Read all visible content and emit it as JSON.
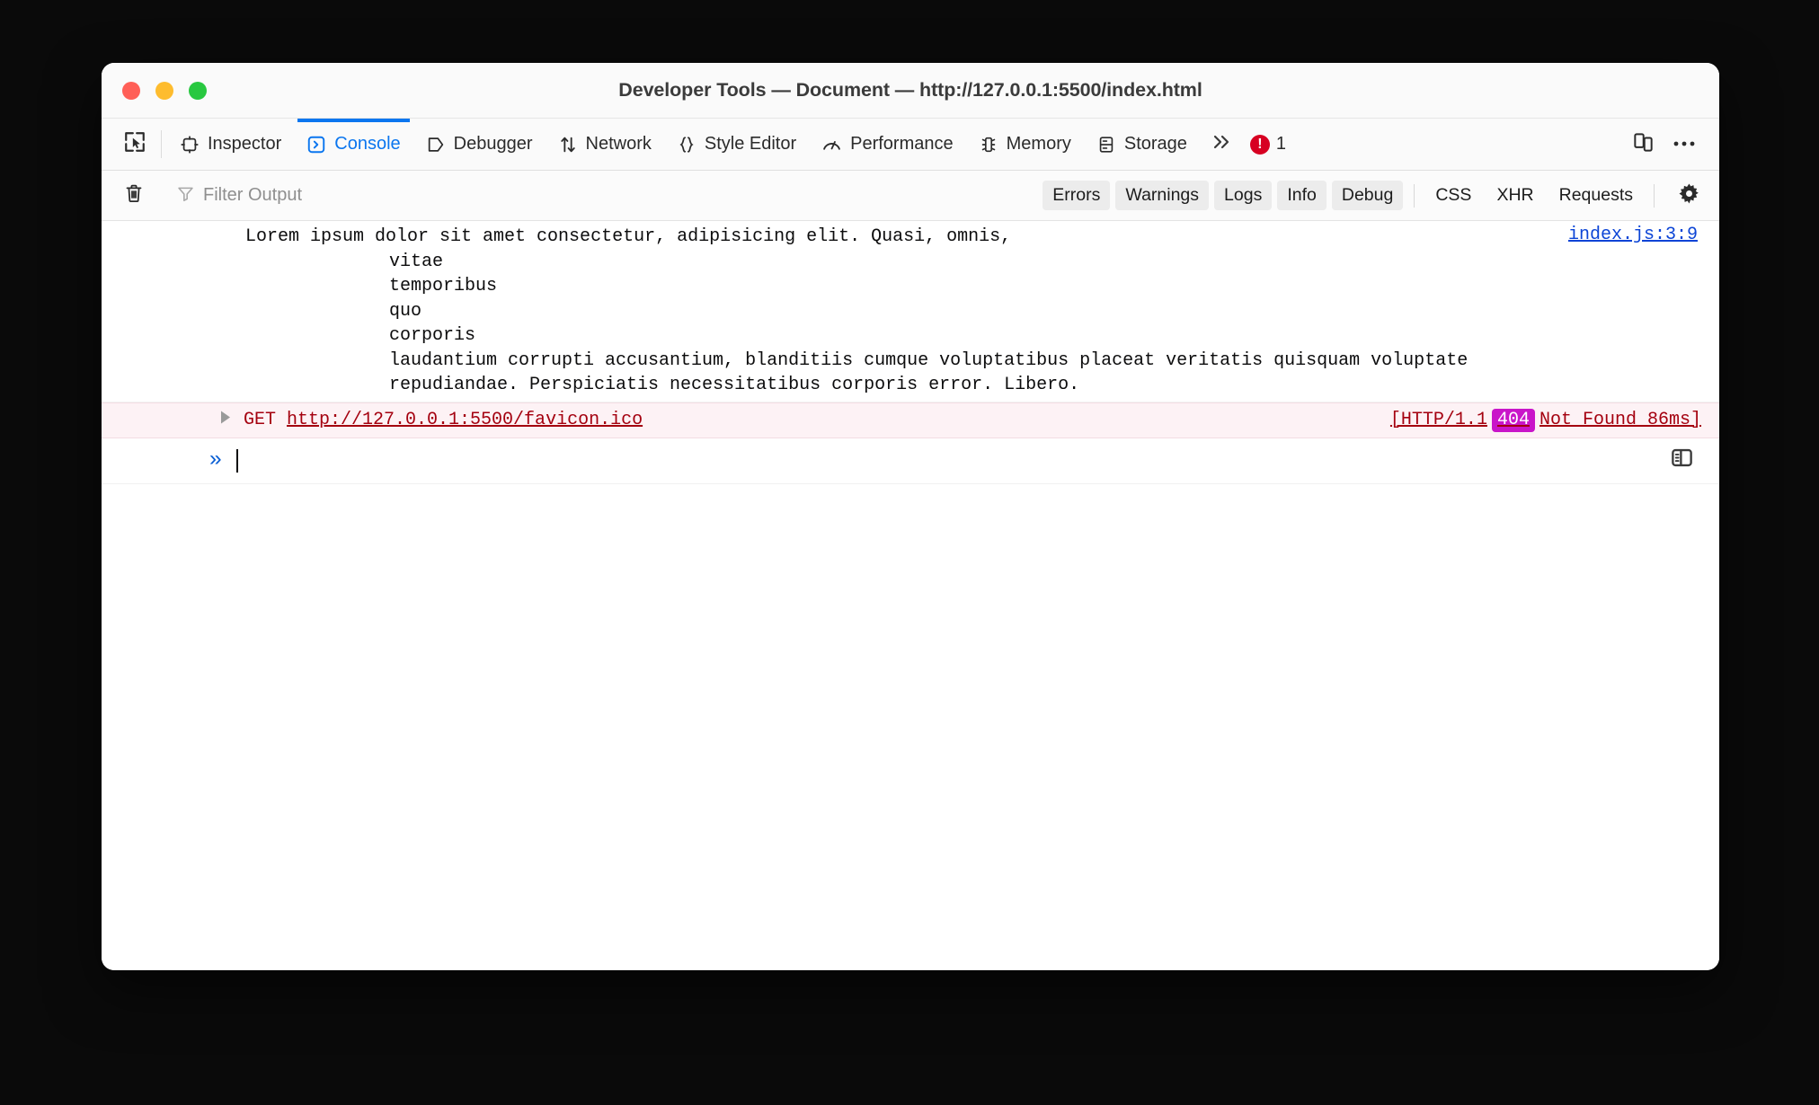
{
  "window": {
    "title": "Developer Tools — Document — http://127.0.0.1:5500/index.html",
    "traffic_lights": {
      "close": "close-button",
      "minimize": "minimize-button",
      "maximize": "maximize-button"
    }
  },
  "toolbar": {
    "picker_icon": "element-picker-icon",
    "tabs": [
      {
        "label": "Inspector",
        "icon": "inspector-icon",
        "active": false
      },
      {
        "label": "Console",
        "icon": "console-icon",
        "active": true
      },
      {
        "label": "Debugger",
        "icon": "debugger-icon",
        "active": false
      },
      {
        "label": "Network",
        "icon": "network-icon",
        "active": false
      },
      {
        "label": "Style Editor",
        "icon": "style-editor-icon",
        "active": false
      },
      {
        "label": "Performance",
        "icon": "performance-icon",
        "active": false
      },
      {
        "label": "Memory",
        "icon": "memory-icon",
        "active": false
      },
      {
        "label": "Storage",
        "icon": "storage-icon",
        "active": false
      }
    ],
    "more_tabs_icon": "chevron-double-right-icon",
    "error_count": "1",
    "error_icon": "error-badge-icon",
    "responsive_mode_icon": "responsive-design-mode-icon",
    "overflow_menu_icon": "meatball-menu-icon"
  },
  "filterbar": {
    "clear_icon": "trash-icon",
    "filter_icon": "funnel-icon",
    "filter_placeholder": "Filter Output",
    "filter_value": "",
    "toggles": [
      {
        "label": "Errors",
        "active": true
      },
      {
        "label": "Warnings",
        "active": true
      },
      {
        "label": "Logs",
        "active": true
      },
      {
        "label": "Info",
        "active": true
      },
      {
        "label": "Debug",
        "active": true
      }
    ],
    "secondary_toggles": [
      {
        "label": "CSS",
        "active": false
      },
      {
        "label": "XHR",
        "active": false
      },
      {
        "label": "Requests",
        "active": false
      }
    ],
    "settings_icon": "gear-icon"
  },
  "console": {
    "log_message": {
      "line1": "Lorem ipsum dolor sit amet consectetur, adipisicing elit. Quasi, omnis,",
      "line2": "vitae",
      "line3": "temporibus",
      "line4": "quo",
      "line5": "corporis",
      "line6": "laudantium corrupti accusantium, blanditiis cumque voluptatibus placeat veritatis quisquam voluptate",
      "line7": "repudiandae. Perspiciatis necessitatibus corporis error. Libero.",
      "source_link": "index.js:3:9"
    },
    "network_error": {
      "expand_icon": "disclosure-triangle-icon",
      "method": "GET",
      "url": "http://127.0.0.1:5500/favicon.ico",
      "status_prefix": "[HTTP/1.1",
      "status_code": "404",
      "status_suffix": "Not Found 86ms]"
    },
    "prompt": {
      "chevron": "»",
      "value": "",
      "split_pane_icon": "split-console-icon"
    }
  },
  "colors": {
    "accent_blue": "#0b76ef",
    "link_blue": "#0b44d6",
    "error_red": "#d70022",
    "network_red": "#a4000f",
    "status_chip": "#c915c9",
    "network_row_bg": "#fdf2f5"
  }
}
